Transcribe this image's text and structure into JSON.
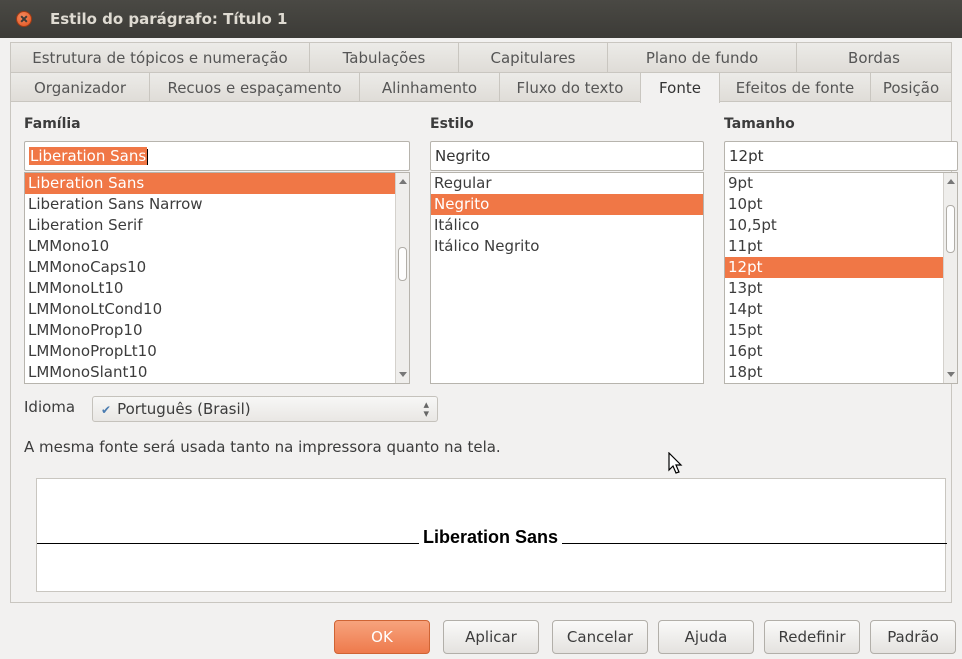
{
  "window": {
    "title": "Estilo do parágrafo: Título 1"
  },
  "tabs_row1": [
    "Estrutura de tópicos e numeração",
    "Tabulações",
    "Capitulares",
    "Plano de fundo",
    "Bordas"
  ],
  "tabs_row2": [
    "Organizador",
    "Recuos e espaçamento",
    "Alinhamento",
    "Fluxo do texto",
    "Fonte",
    "Efeitos de fonte",
    "Posição"
  ],
  "active_tab": "Fonte",
  "family": {
    "label": "Família",
    "value": "Liberation Sans",
    "items": [
      "Liberation Sans",
      "Liberation Sans Narrow",
      "Liberation Serif",
      "LMMono10",
      "LMMonoCaps10",
      "LMMonoLt10",
      "LMMonoLtCond10",
      "LMMonoProp10",
      "LMMonoPropLt10",
      "LMMonoSlant10"
    ],
    "selected_index": 0
  },
  "style": {
    "label": "Estilo",
    "value": "Negrito",
    "items": [
      "Regular",
      "Negrito",
      "Itálico",
      "Itálico Negrito"
    ],
    "selected_index": 1
  },
  "size": {
    "label": "Tamanho",
    "value": "12pt",
    "items": [
      "9pt",
      "10pt",
      "10,5pt",
      "11pt",
      "12pt",
      "13pt",
      "14pt",
      "15pt",
      "16pt",
      "18pt"
    ],
    "selected_index": 4
  },
  "language": {
    "label": "Idioma",
    "value": "Português (Brasil)"
  },
  "info_text": "A mesma fonte será usada tanto na impressora quanto na tela.",
  "preview_text": "Liberation Sans",
  "buttons": {
    "ok": "OK",
    "apply": "Aplicar",
    "cancel": "Cancelar",
    "help": "Ajuda",
    "reset": "Redefinir",
    "default": "Padrão"
  },
  "colors": {
    "selection": "#f07746",
    "titlebar": "#3c3b37"
  }
}
